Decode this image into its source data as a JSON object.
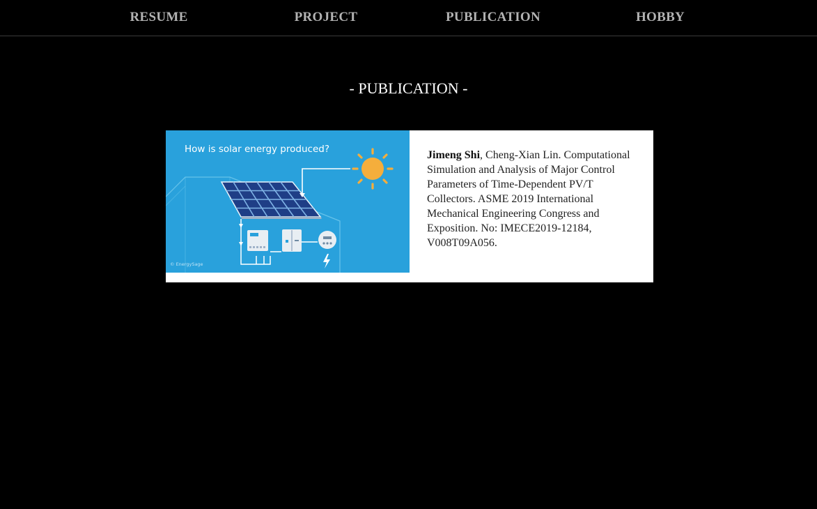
{
  "nav": {
    "items": [
      {
        "label": "RESUME"
      },
      {
        "label": "PROJECT"
      },
      {
        "label": "PUBLICATION"
      },
      {
        "label": "HOBBY"
      }
    ]
  },
  "section": {
    "title": "- PUBLICATION -"
  },
  "publications": [
    {
      "image_caption": "How is solar energy produced?",
      "image_credit": "© EnergySage",
      "author_bold": "Jimeng Shi",
      "citation_rest": ", Cheng-Xian Lin. Computational Simulation and Analysis of Major Control Parameters of Time-Dependent PV/T Collectors. ASME 2019 International Mechanical Engineering Congress and Exposition. No: IMECE2019-12184, V008T09A056."
    }
  ],
  "colors": {
    "background": "#000000",
    "nav_text": "#b3b3b3",
    "image_bg": "#29a1dc",
    "sun": "#f5ae3c",
    "panel": "#1f3e86"
  }
}
